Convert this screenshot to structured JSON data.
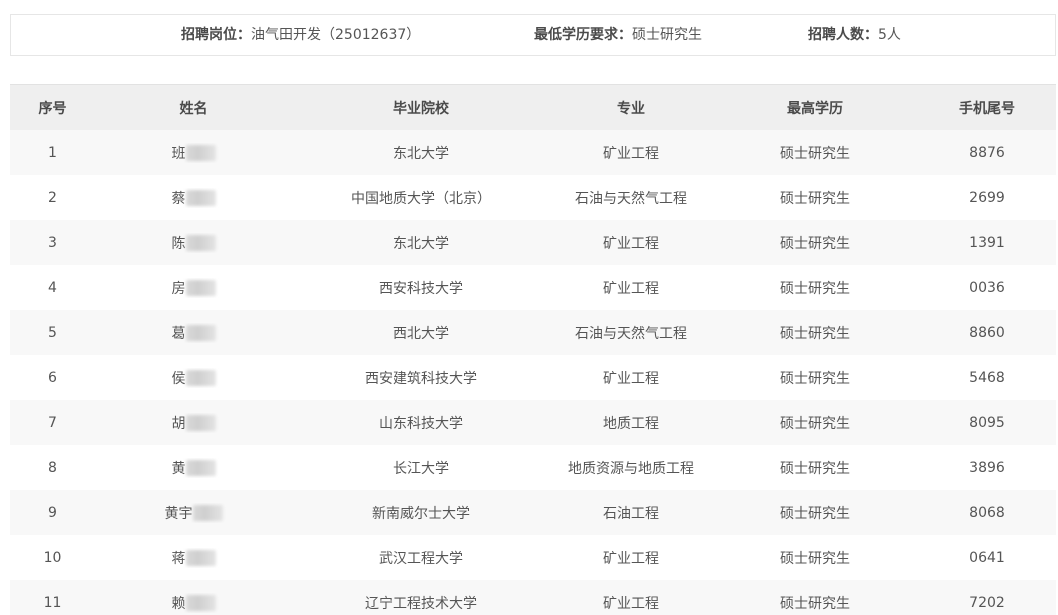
{
  "info": {
    "position_label": "招聘岗位",
    "position_value": "油气田开发（25012637）",
    "education_label": "最低学历要求",
    "education_value": "硕士研究生",
    "count_label": "招聘人数",
    "count_value": "5人",
    "colon": "："
  },
  "table": {
    "headers": {
      "index": "序号",
      "name": "姓名",
      "school": "毕业院校",
      "major": "专业",
      "degree": "最高学历",
      "phone": "手机尾号"
    },
    "rows": [
      {
        "index": "1",
        "name": "班",
        "school": "东北大学",
        "major": "矿业工程",
        "degree": "硕士研究生",
        "phone": "8876"
      },
      {
        "index": "2",
        "name": "蔡",
        "school": "中国地质大学（北京）",
        "major": "石油与天然气工程",
        "degree": "硕士研究生",
        "phone": "2699"
      },
      {
        "index": "3",
        "name": "陈",
        "school": "东北大学",
        "major": "矿业工程",
        "degree": "硕士研究生",
        "phone": "1391"
      },
      {
        "index": "4",
        "name": "房",
        "school": "西安科技大学",
        "major": "矿业工程",
        "degree": "硕士研究生",
        "phone": "0036"
      },
      {
        "index": "5",
        "name": "葛",
        "school": "西北大学",
        "major": "石油与天然气工程",
        "degree": "硕士研究生",
        "phone": "8860"
      },
      {
        "index": "6",
        "name": "侯",
        "school": "西安建筑科技大学",
        "major": "矿业工程",
        "degree": "硕士研究生",
        "phone": "5468"
      },
      {
        "index": "7",
        "name": "胡",
        "school": "山东科技大学",
        "major": "地质工程",
        "degree": "硕士研究生",
        "phone": "8095"
      },
      {
        "index": "8",
        "name": "黄",
        "school": "长江大学",
        "major": "地质资源与地质工程",
        "degree": "硕士研究生",
        "phone": "3896"
      },
      {
        "index": "9",
        "name": "黄宇",
        "school": "新南威尔士大学",
        "major": "石油工程",
        "degree": "硕士研究生",
        "phone": "8068"
      },
      {
        "index": "10",
        "name": "蒋",
        "school": "武汉工程大学",
        "major": "矿业工程",
        "degree": "硕士研究生",
        "phone": "0641"
      },
      {
        "index": "11",
        "name": "赖",
        "school": "辽宁工程技术大学",
        "major": "矿业工程",
        "degree": "硕士研究生",
        "phone": "7202"
      }
    ]
  }
}
